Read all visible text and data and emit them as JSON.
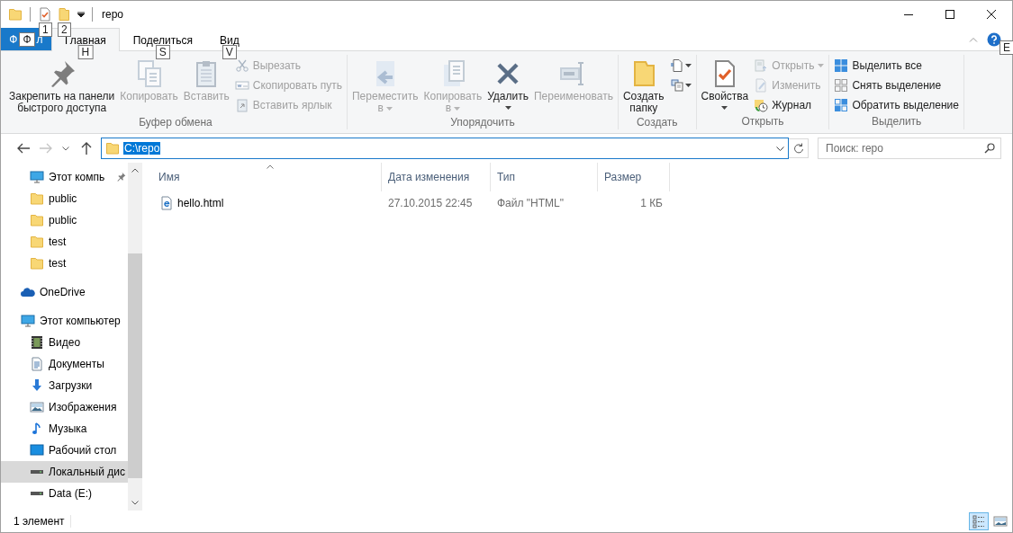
{
  "title_bar": {
    "quick_access": [
      {
        "kind": "properties",
        "keytip": "1"
      },
      {
        "kind": "new-folder",
        "keytip": "2"
      }
    ],
    "title": "repo"
  },
  "ribbon": {
    "file_tab": {
      "label_start": "Ф",
      "keytip": "Ф",
      "label_end": "л"
    },
    "tabs": [
      {
        "label": "Главная",
        "keytip": "H",
        "selected": true
      },
      {
        "label": "Поделиться",
        "keytip": "S",
        "selected": false
      },
      {
        "label": "Вид",
        "keytip": "V",
        "selected": false
      }
    ],
    "help_keytip": "E",
    "groups": [
      {
        "title": "Буфер обмена",
        "buttons": [
          {
            "kind": "pin",
            "large": true,
            "lines": [
              "Закрепить на панели",
              "быстрого доступа"
            ],
            "disabled": false,
            "dropdown": false
          },
          {
            "kind": "copy",
            "large": true,
            "lines": [
              "Копировать"
            ],
            "disabled": true,
            "dropdown": false
          },
          {
            "kind": "paste",
            "large": true,
            "lines": [
              "Вставить"
            ],
            "disabled": true,
            "dropdown": false
          },
          {
            "kind": "cut",
            "large": false,
            "label": "Вырезать",
            "disabled": true,
            "dropdown": false
          },
          {
            "kind": "copy-path",
            "large": false,
            "label": "Скопировать путь",
            "disabled": true,
            "dropdown": false
          },
          {
            "kind": "paste-shortcut",
            "large": false,
            "label": "Вставить ярлык",
            "disabled": true,
            "dropdown": false
          }
        ]
      },
      {
        "title": "Упорядочить",
        "buttons": [
          {
            "kind": "move-to",
            "large": true,
            "lines": [
              "Переместить",
              "в"
            ],
            "disabled": true,
            "dropdown": true
          },
          {
            "kind": "copy-to",
            "large": true,
            "lines": [
              "Копировать",
              "в"
            ],
            "disabled": true,
            "dropdown": true
          },
          {
            "kind": "delete",
            "large": true,
            "lines": [
              "Удалить"
            ],
            "disabled": false,
            "dropdown": true
          },
          {
            "kind": "rename",
            "large": true,
            "lines": [
              "Переименовать"
            ],
            "disabled": true,
            "dropdown": false
          }
        ]
      },
      {
        "title": "Создать",
        "buttons": [
          {
            "kind": "new-folder",
            "large": true,
            "lines": [
              "Создать",
              "папку"
            ],
            "disabled": false,
            "dropdown": false
          },
          {
            "kind": "new-item",
            "large": false,
            "disabled": false,
            "dropdown": true
          },
          {
            "kind": "easy-access",
            "large": false,
            "disabled": false,
            "dropdown": true
          }
        ]
      },
      {
        "title": "Открыть",
        "buttons": [
          {
            "kind": "properties",
            "large": true,
            "lines": [
              "Свойства"
            ],
            "disabled": false,
            "dropdown": true
          },
          {
            "kind": "open",
            "large": false,
            "label": "Открыть",
            "disabled": true,
            "dropdown": true
          },
          {
            "kind": "edit",
            "large": false,
            "label": "Изменить",
            "disabled": true,
            "dropdown": false
          },
          {
            "kind": "history",
            "large": false,
            "label": "Журнал",
            "disabled": false,
            "dropdown": false
          }
        ]
      },
      {
        "title": "Выделить",
        "buttons": [
          {
            "kind": "select-all",
            "large": false,
            "label": "Выделить все",
            "disabled": false,
            "dropdown": false
          },
          {
            "kind": "select-none",
            "large": false,
            "label": "Снять выделение",
            "disabled": false,
            "dropdown": false
          },
          {
            "kind": "invert",
            "large": false,
            "label": "Обратить выделение",
            "disabled": false,
            "dropdown": false
          }
        ]
      }
    ]
  },
  "address_bar": {
    "path": "C:\\repo",
    "search": {
      "placeholder": "Поиск: repo"
    }
  },
  "navigation": {
    "quick_access_items": [
      {
        "kind": "computer",
        "label": "Этот компь",
        "pinned": true,
        "selected": false
      },
      {
        "kind": "folder",
        "label": "public",
        "pinned": false,
        "selected": false
      },
      {
        "kind": "folder",
        "label": "public",
        "pinned": false,
        "selected": false
      },
      {
        "kind": "folder",
        "label": "test",
        "pinned": false,
        "selected": false
      },
      {
        "kind": "folder",
        "label": "test",
        "pinned": false,
        "selected": false
      }
    ],
    "items": [
      {
        "kind": "cloud",
        "label": "OneDrive",
        "selected": false
      },
      {
        "kind": "computer",
        "label": "Этот компьютер",
        "selected": false,
        "children": [
          {
            "kind": "video",
            "label": "Видео",
            "selected": false
          },
          {
            "kind": "documents",
            "label": "Документы",
            "selected": false
          },
          {
            "kind": "downloads",
            "label": "Загрузки",
            "selected": false
          },
          {
            "kind": "pictures",
            "label": "Изображения",
            "selected": false
          },
          {
            "kind": "music",
            "label": "Музыка",
            "selected": false
          },
          {
            "kind": "desktop",
            "label": "Рабочий стол",
            "selected": false
          },
          {
            "kind": "drive",
            "label": "Локальный дис",
            "selected": true
          },
          {
            "kind": "drive",
            "label": "Data (E:)",
            "selected": false
          }
        ]
      }
    ]
  },
  "file_list": {
    "columns": [
      "Имя",
      "Дата изменения",
      "Тип",
      "Размер"
    ],
    "rows": [
      {
        "kind": "html",
        "name": "hello.html",
        "modified": "27.10.2015 22:45",
        "type": "Файл \"HTML\"",
        "size": "1 КБ"
      }
    ]
  },
  "status_bar": {
    "text": "1 элемент",
    "views": [
      {
        "kind": "details",
        "selected": true
      },
      {
        "kind": "large-icons",
        "selected": false
      }
    ]
  }
}
